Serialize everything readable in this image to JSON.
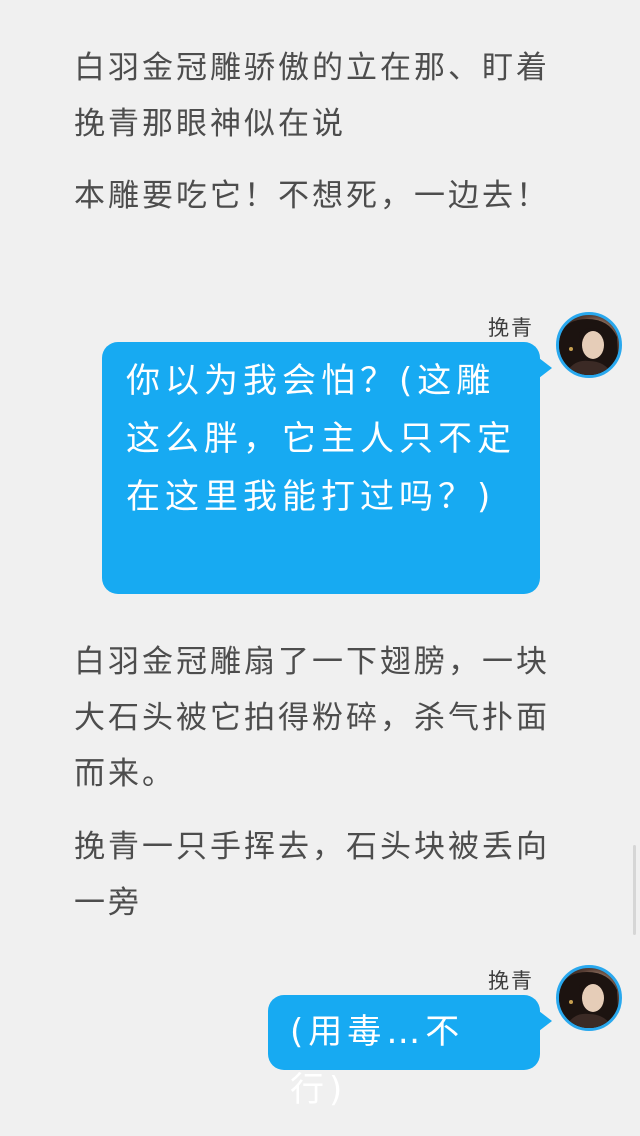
{
  "story": {
    "narration_1": "白羽金冠雕骄傲的立在那、盯着挽青那眼神似在说",
    "narration_2": "本雕要吃它！不想死，一边去！",
    "narration_3": "白羽金冠雕扇了一下翅膀，一块大石头被它拍得粉碎，杀气扑面而来。",
    "narration_4": "挽青一只手挥去，石头块被丢向一旁"
  },
  "messages": [
    {
      "speaker": "挽青",
      "text": "你以为我会怕？(这雕这么胖，它主人只不定在这里我能打过吗？)",
      "avatar_icon": "avatar-portrait"
    },
    {
      "speaker": "挽青",
      "text": "(用毒…不行)",
      "avatar_icon": "avatar-portrait"
    }
  ],
  "colors": {
    "background": "#f0f0f0",
    "bubble": "#17aaf2",
    "avatar_border": "#29a8ee",
    "text": "#4d4d4d"
  }
}
